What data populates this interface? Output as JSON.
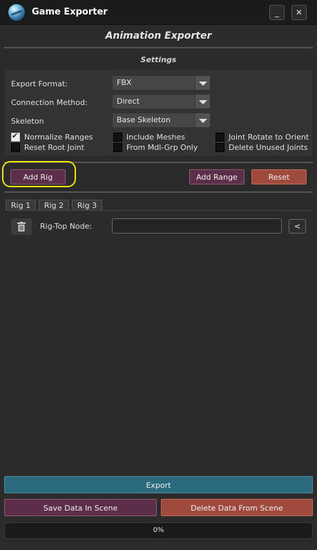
{
  "window": {
    "title": "Game Exporter",
    "minimize": "_",
    "close": "✕"
  },
  "header": {
    "title": "Animation Exporter"
  },
  "settings": {
    "title": "Settings",
    "export_format": {
      "label": "Export Format:",
      "value": "FBX"
    },
    "connection_method": {
      "label": "Connection Method:",
      "value": "Direct"
    },
    "skeleton": {
      "label": "Skeleton",
      "value": "Base Skeleton"
    },
    "checkboxes": {
      "normalize_ranges": {
        "label": "Normalize Ranges",
        "checked": true
      },
      "include_meshes": {
        "label": "Include Meshes",
        "checked": false
      },
      "joint_rotate": {
        "label": "Joint Rotate to Orient",
        "checked": false
      },
      "reset_root": {
        "label": "Reset Root Joint",
        "checked": false
      },
      "from_mdl_grp": {
        "label": "From Mdl-Grp Only",
        "checked": false
      },
      "delete_unused": {
        "label": "Delete Unused Joints",
        "checked": false
      }
    }
  },
  "actions": {
    "add_rig": "Add Rig",
    "add_range": "Add Range",
    "reset": "Reset"
  },
  "tabs": [
    {
      "label": "Rig 1"
    },
    {
      "label": "Rig 2"
    },
    {
      "label": "Rig 3"
    }
  ],
  "rig": {
    "top_node_label": "Rig-Top Node:",
    "top_node_value": "",
    "pick_button": "<",
    "delete_icon": "trash-icon"
  },
  "footer": {
    "export": "Export",
    "save_data": "Save Data In Scene",
    "delete_data": "Delete Data From Scene",
    "progress": "0%"
  },
  "colors": {
    "accent_purple": "#5d2e4a",
    "accent_red": "#a04a3e",
    "accent_teal": "#2c6a7e",
    "highlight": "#f2e600"
  }
}
